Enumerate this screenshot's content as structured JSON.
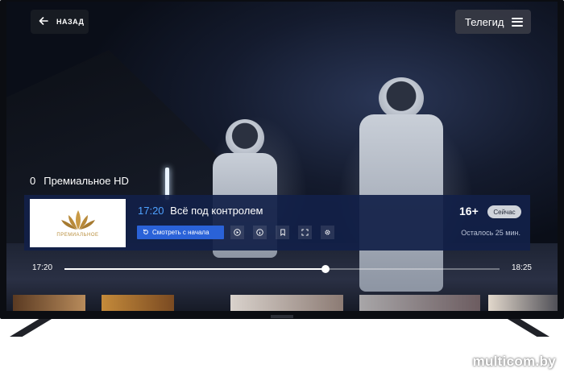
{
  "top_bar": {
    "back_label": "НАЗАД",
    "guide_label": "Телегид"
  },
  "channel": {
    "number": "0",
    "name": "Премиальное HD",
    "logo_text": "ПРЕМИАЛЬНОЕ"
  },
  "program": {
    "start_time": "17:20",
    "title": "Всё под контролем",
    "age_rating": "16+",
    "now_badge": "Сейчас",
    "watch_from_start_label": "Смотреть с начала",
    "remaining": "Осталось 25 мин."
  },
  "timeline": {
    "start": "17:20",
    "end": "18:25",
    "progress": 0.6
  },
  "watermark": "multicom.by",
  "icons": [
    "arrow-left",
    "hamburger-menu",
    "replay",
    "play",
    "info",
    "bookmark",
    "fullscreen",
    "gear"
  ]
}
